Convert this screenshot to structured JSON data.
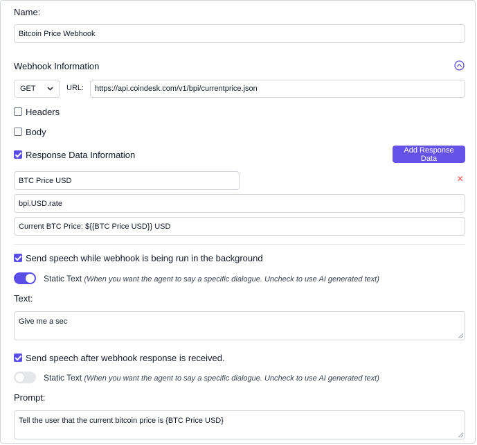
{
  "form": {
    "name_label": "Name:",
    "name_value": "Bitcoin Price Webhook",
    "webhook_info_label": "Webhook Information",
    "method_value": "GET",
    "url_label": "URL:",
    "url_value": "https://api.coindesk.com/v1/bpi/currentprice.json",
    "headers_label": "Headers",
    "body_label": "Body",
    "response_label": "Response Data Information",
    "add_response_button": "Add Response Data",
    "response_name_value": "BTC Price USD",
    "response_path_value": "bpi.USD.rate",
    "response_template_value": "Current BTC Price: ${{BTC Price USD}} USD",
    "remove_icon_glyph": "×",
    "send_bg_label": "Send speech while webhook is being run in the background",
    "static_text_label": "Static Text",
    "static_text_hint": "(When you want the agent to say a specific dialogue. Uncheck to use AI generated text)",
    "text_label": "Text:",
    "text_value": "Give me a sec",
    "send_after_label": "Send speech after webhook response is received.",
    "static_text_label_2": "Static Text",
    "static_text_hint_2": "(When you want the agent to say a specific dialogue. Uncheck to use AI generated text)",
    "prompt_label": "Prompt:",
    "prompt_value": "Tell the user that the current bitcoin price is {BTC Price USD}",
    "headers_checked": false,
    "body_checked": false,
    "response_checked": true,
    "send_bg_checked": true,
    "static_text_1_on": true,
    "send_after_checked": true,
    "static_text_2_on": false
  },
  "icons": {
    "collapse": "chevron-up-circle-icon",
    "dropdown": "chevron-down-icon",
    "remove": "close-icon"
  },
  "colors": {
    "accent": "#5b4ee8",
    "remove_red": "#ef4444",
    "border": "#d1d5db"
  }
}
